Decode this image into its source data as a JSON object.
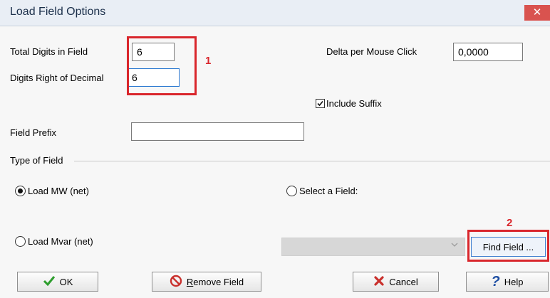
{
  "window": {
    "title": "Load Field Options",
    "close_glyph": "✕"
  },
  "fields": {
    "total_digits": {
      "label": "Total Digits in Field",
      "value": "6"
    },
    "digits_right": {
      "label": "Digits Right of Decimal",
      "value": "6"
    },
    "delta": {
      "label": "Delta per Mouse Click",
      "value": "0,0000"
    },
    "include_suffix": {
      "label": "Include Suffix",
      "checked": true
    },
    "prefix": {
      "label": "Field Prefix",
      "value": ""
    }
  },
  "type_of_field": {
    "label": "Type of Field",
    "options": [
      {
        "label": "Load MW (net)",
        "checked": true
      },
      {
        "label": "Select a Field:",
        "checked": false
      },
      {
        "label": "Load Mvar (net)",
        "checked": false
      }
    ],
    "select_value": ""
  },
  "annotations": {
    "marker1": "1",
    "marker2": "2",
    "color": "#d9262c"
  },
  "buttons": {
    "find_field": "Find Field ...",
    "ok": "OK",
    "remove_field": "emove Field",
    "remove_field_hotkey": "R",
    "cancel": "Cancel",
    "help": "Help"
  }
}
